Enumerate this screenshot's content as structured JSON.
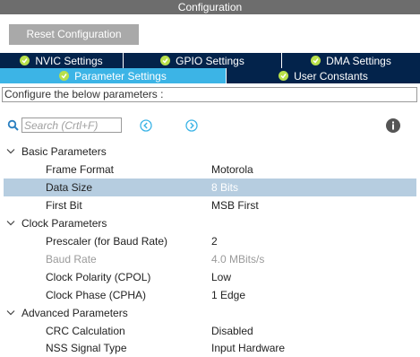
{
  "window": {
    "title": "Configuration"
  },
  "toolbar": {
    "reset_label": "Reset Configuration"
  },
  "tabs_row1": [
    {
      "label": "NVIC Settings"
    },
    {
      "label": "GPIO Settings"
    },
    {
      "label": "DMA Settings"
    }
  ],
  "tabs_row2": [
    {
      "label": "Parameter Settings",
      "active": true
    },
    {
      "label": "User Constants"
    }
  ],
  "description": "Configure the below parameters :",
  "search": {
    "placeholder": "Search (Crtl+F)",
    "value": ""
  },
  "groups": [
    {
      "label": "Basic Parameters",
      "params": [
        {
          "label": "Frame Format",
          "value": "Motorola"
        },
        {
          "label": "Data Size",
          "value": "8 Bits",
          "selected": true
        },
        {
          "label": "First Bit",
          "value": "MSB First"
        }
      ]
    },
    {
      "label": "Clock Parameters",
      "params": [
        {
          "label": "Prescaler (for Baud Rate)",
          "value": "2"
        },
        {
          "label": "Baud Rate",
          "value": "4.0 MBits/s",
          "disabled": true
        },
        {
          "label": "Clock Polarity (CPOL)",
          "value": "Low"
        },
        {
          "label": "Clock Phase (CPHA)",
          "value": "1 Edge"
        }
      ]
    },
    {
      "label": "Advanced Parameters",
      "params": [
        {
          "label": "CRC Calculation",
          "value": "Disabled"
        },
        {
          "label": "NSS Signal Type",
          "value": "Input Hardware"
        }
      ]
    }
  ],
  "colors": {
    "tab_dark": "#03234b",
    "tab_active": "#3cb4e6",
    "check": "#b8e04a",
    "selected_row": "#b6cde0",
    "nav_icon": "#3cb4e6"
  }
}
